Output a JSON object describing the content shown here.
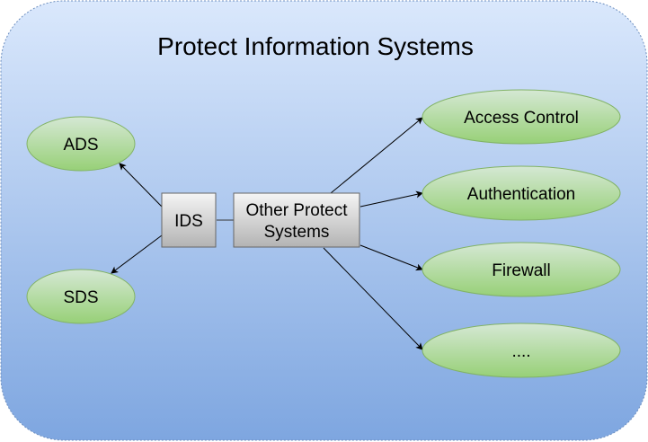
{
  "title": "Protect Information Systems",
  "nodes": {
    "ads": "ADS",
    "sds": "SDS",
    "ids": "IDS",
    "other_line1": "Other Protect",
    "other_line2": "Systems",
    "access": "Access Control",
    "auth": "Authentication",
    "firewall": "Firewall",
    "more": "...."
  },
  "colors": {
    "bg_top": "#dae8fc",
    "bg_bottom": "#7ea6e0",
    "ellipse_top": "#d5e8d4",
    "ellipse_bottom": "#97d077",
    "box_top": "#f5f5f5",
    "box_bottom": "#b3b3b3"
  }
}
